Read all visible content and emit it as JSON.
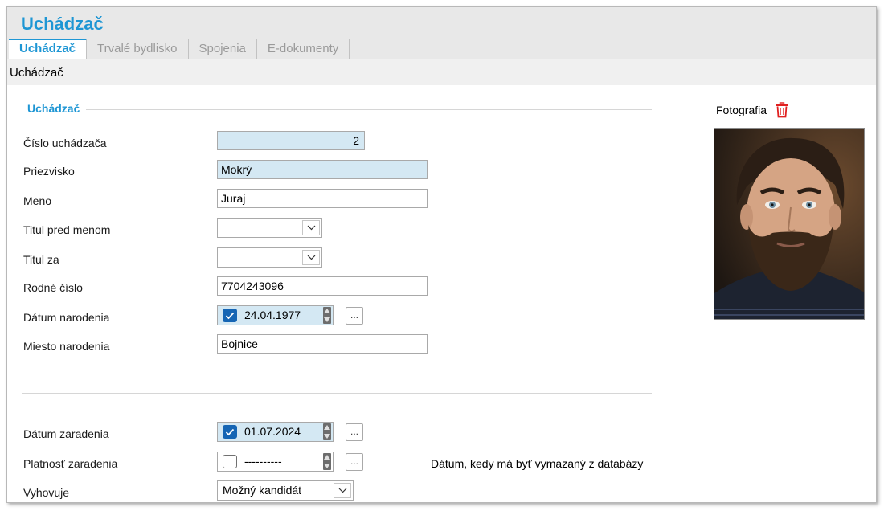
{
  "app": {
    "title": "Uchádzač"
  },
  "tabs": [
    {
      "label": "Uchádzač",
      "active": true
    },
    {
      "label": "Trvalé bydlisko",
      "active": false
    },
    {
      "label": "Spojenia",
      "active": false
    },
    {
      "label": "E-dokumenty",
      "active": false
    }
  ],
  "section": {
    "title": "Uchádzač"
  },
  "group": {
    "title": "Uchádzač"
  },
  "fields": {
    "cislo": {
      "label": "Číslo uchádzača",
      "value": "2"
    },
    "priezvisko": {
      "label": "Priezvisko",
      "value": "Mokrý"
    },
    "meno": {
      "label": "Meno",
      "value": "Juraj"
    },
    "titul_pred": {
      "label": "Titul pred menom",
      "value": ""
    },
    "titul_za": {
      "label": "Titul za",
      "value": ""
    },
    "rodne_cislo": {
      "label": "Rodné číslo",
      "value": "7704243096"
    },
    "datum_narodenia": {
      "label": "Dátum narodenia",
      "value": "24.04.1977",
      "checked": true
    },
    "miesto_narodenia": {
      "label": "Miesto narodenia",
      "value": "Bojnice"
    },
    "datum_zaradenia": {
      "label": "Dátum zaradenia",
      "value": "01.07.2024",
      "checked": true
    },
    "platnost_zaradenia": {
      "label": "Platnosť zaradenia",
      "value": "----------",
      "checked": false
    },
    "vyhovuje": {
      "label": "Vyhovuje",
      "value": "Možný kandidát"
    }
  },
  "platnost_note": "Dátum, kedy má byť vymazaný z databázy",
  "photo": {
    "label": "Fotografia"
  },
  "buttons": {
    "dots": "..."
  },
  "colors": {
    "accent": "#1e96d4",
    "readonly_bg": "#d4e8f3",
    "checkbox": "#1565b4",
    "trash": "#e02020"
  }
}
